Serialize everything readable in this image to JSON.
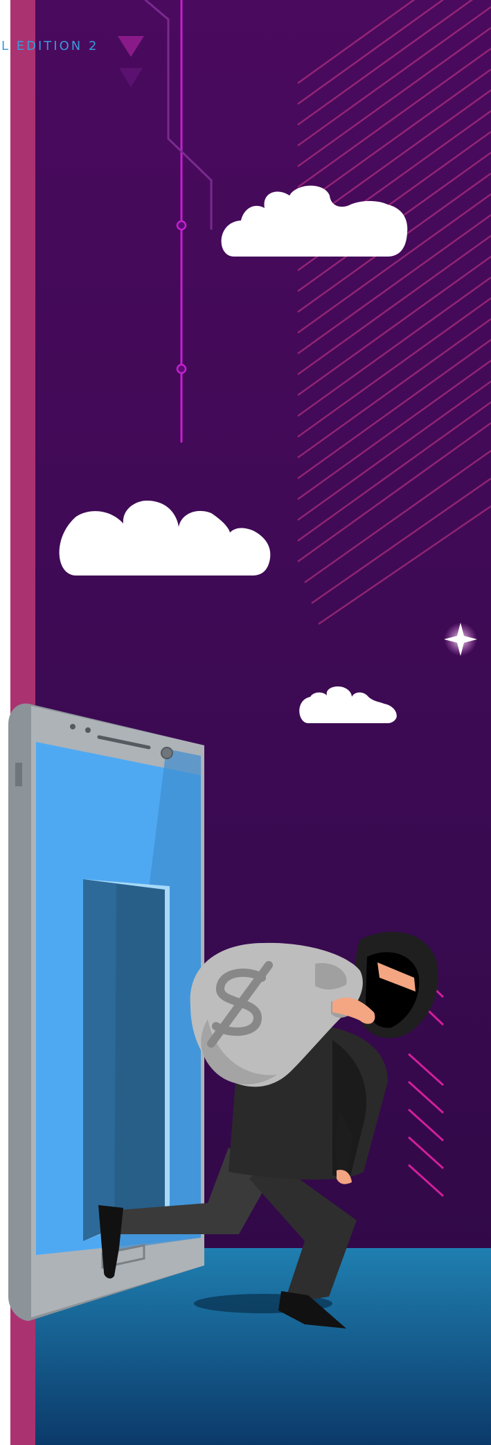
{
  "header": {
    "edition_label": "L EDITION 2"
  },
  "colors": {
    "background_top": "#4a0a5e",
    "background_mid": "#33084a",
    "side_stripe": "#ab3270",
    "floor_top": "#1f7fb0",
    "floor_bottom": "#0b3a6a",
    "phone_body": "#a9aeb3",
    "phone_screen": "#4fa9f2",
    "door": "#2d6a99",
    "cloud": "#ffffff",
    "circuit_line": "#c51fcf",
    "thief_suit": "#2a2a2a",
    "money_bag": "#bdbdbd"
  },
  "scene": {
    "icons": [
      "triangle-icon",
      "cloud-icon",
      "sparkle-icon",
      "smartphone-icon",
      "door-icon",
      "thief-icon",
      "money-bag-icon",
      "dollar-sign-icon"
    ]
  }
}
